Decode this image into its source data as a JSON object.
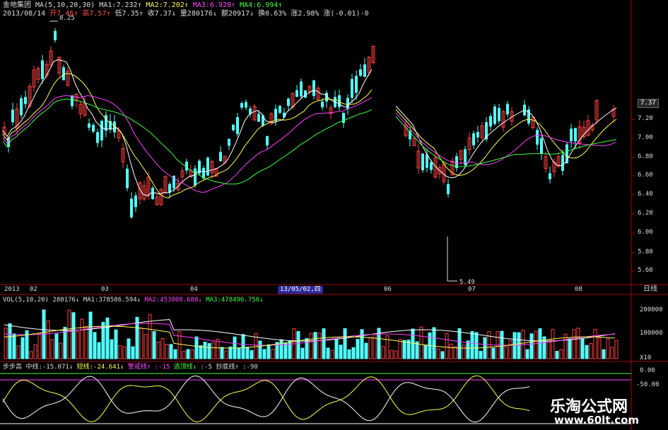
{
  "header": {
    "stock_name": "金地集团",
    "ma_label": "MA(5,10,20,30)",
    "ma1": "MA1:7.232↑",
    "ma2": "MA2:7.202↑",
    "ma3": "MA3:6.928↑",
    "ma4": "MA4:6.994↑",
    "date": "2013/08/14",
    "open": "开7.46↑",
    "high": "高7.57↑",
    "low": "低7.35↑",
    "close": "收7.37↓",
    "volume": "量280176↓",
    "amount": "额20917↓",
    "turnover": "换0.63%",
    "change": "涨2.98%",
    "strength": "涨(-0.01)-0"
  },
  "main_chart": {
    "high_marker": "8.25",
    "low_marker": "5.49",
    "current_price_tag": "7.37",
    "y_ticks": [
      "7.20",
      "7.00",
      "6.80",
      "6.60",
      "6.40",
      "6.20",
      "6.00",
      "5.80",
      "5.60"
    ],
    "x_labels": [
      "2013",
      "02",
      "03",
      "04",
      "06",
      "07",
      "08"
    ],
    "cursor_date": "13/05/02,四",
    "period_label": "日线"
  },
  "volume_panel": {
    "label": "VOL(5,10,20)",
    "value": "280176↓",
    "ma1": "MA1:378586.594↓",
    "ma2": "MA2:453008.688↓",
    "ma3": "MA3:478496.750↓",
    "y_ticks": [
      "200000",
      "100000"
    ],
    "unit": "X10"
  },
  "indicator_panel": {
    "name": "步步高",
    "mid_line": "中线:-15.071↓",
    "short_line": "短线:-24.641↓",
    "warning_line": "警戒线↑",
    "warning_val": ":-15",
    "top_line": "逃顶线↓",
    "top_val": ":-5",
    "bottom_line": "抄底线↑",
    "bottom_val": ":-90",
    "y_ticks": [
      "0.00",
      "-50.00"
    ]
  },
  "watermark": {
    "title": "乐淘公式网",
    "url": "www.60lt.com"
  },
  "colors": {
    "up": "#ff4040",
    "down": "#54ffff",
    "ma1": "#ffffff",
    "ma2": "#ffff55",
    "ma3": "#ff40ff",
    "ma4": "#40ff40",
    "grid": "#aa0000"
  }
}
